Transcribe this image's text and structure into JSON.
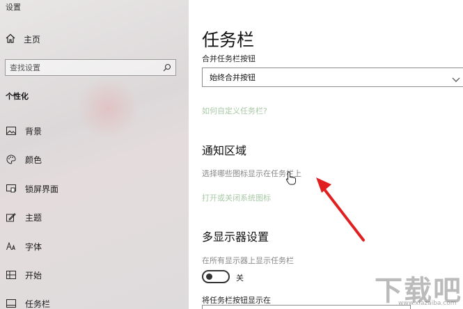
{
  "window": {
    "title": "设置"
  },
  "sidebar": {
    "home_label": "主页",
    "search_placeholder": "查找设置",
    "section_label": "个性化",
    "items": [
      {
        "label": "背景",
        "icon": "image-icon"
      },
      {
        "label": "颜色",
        "icon": "palette-icon"
      },
      {
        "label": "锁屏界面",
        "icon": "lock-screen-icon"
      },
      {
        "label": "主题",
        "icon": "brush-icon"
      },
      {
        "label": "字体",
        "icon": "font-icon"
      },
      {
        "label": "开始",
        "icon": "start-grid-icon"
      },
      {
        "label": "任务栏",
        "icon": "taskbar-icon"
      }
    ]
  },
  "main": {
    "title": "任务栏",
    "combine_label": "合并任务栏按钮",
    "combine_value": "始终合并按钮",
    "customize_link": "如何自定义任务栏?",
    "notification_heading": "通知区域",
    "select_icons_text": "选择哪些图标显示在任务栏上",
    "system_icons_link": "打开或关闭系统图标",
    "multi_display_heading": "多显示器设置",
    "show_all_displays_label": "在所有显示器上显示任务栏",
    "toggle_state": "关",
    "buttons_on_label": "将任务栏按钮显示在"
  },
  "watermark": {
    "brand": "下载吧",
    "url": "www.xiazaiba.com"
  },
  "colors": {
    "link": "#a9c9a6",
    "arrow": "#e02020",
    "sidebar_bg": "#e2dfe0"
  }
}
